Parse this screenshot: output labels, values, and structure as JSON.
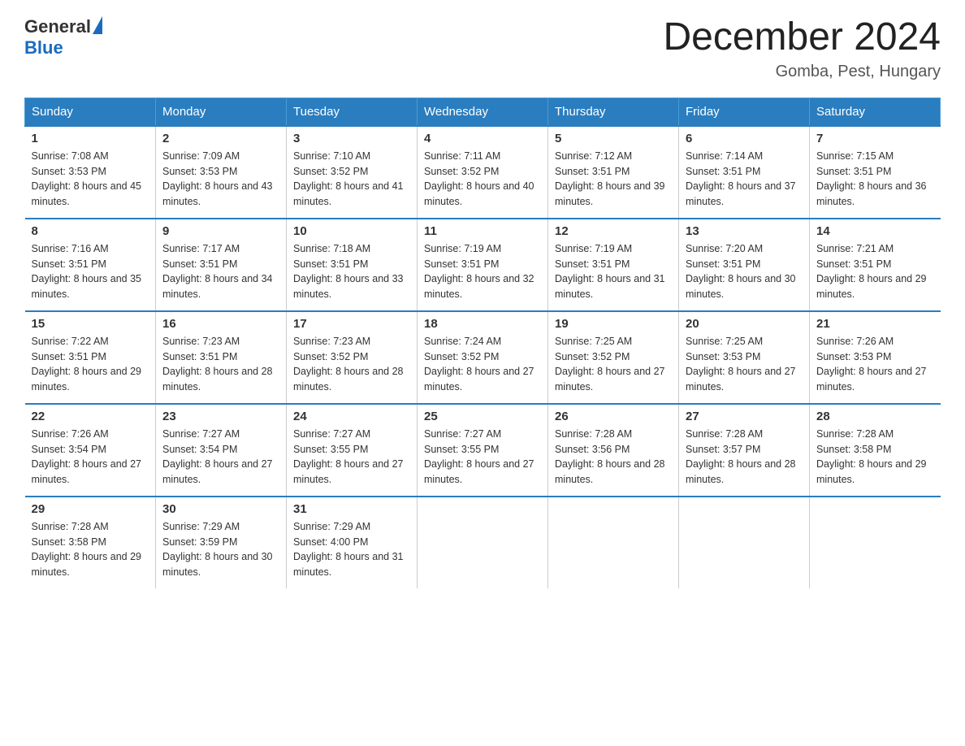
{
  "logo": {
    "general": "General",
    "blue": "Blue"
  },
  "title": {
    "month_year": "December 2024",
    "location": "Gomba, Pest, Hungary"
  },
  "weekdays": [
    "Sunday",
    "Monday",
    "Tuesday",
    "Wednesday",
    "Thursday",
    "Friday",
    "Saturday"
  ],
  "weeks": [
    [
      {
        "day": "1",
        "sunrise": "7:08 AM",
        "sunset": "3:53 PM",
        "daylight": "8 hours and 45 minutes."
      },
      {
        "day": "2",
        "sunrise": "7:09 AM",
        "sunset": "3:53 PM",
        "daylight": "8 hours and 43 minutes."
      },
      {
        "day": "3",
        "sunrise": "7:10 AM",
        "sunset": "3:52 PM",
        "daylight": "8 hours and 41 minutes."
      },
      {
        "day": "4",
        "sunrise": "7:11 AM",
        "sunset": "3:52 PM",
        "daylight": "8 hours and 40 minutes."
      },
      {
        "day": "5",
        "sunrise": "7:12 AM",
        "sunset": "3:51 PM",
        "daylight": "8 hours and 39 minutes."
      },
      {
        "day": "6",
        "sunrise": "7:14 AM",
        "sunset": "3:51 PM",
        "daylight": "8 hours and 37 minutes."
      },
      {
        "day": "7",
        "sunrise": "7:15 AM",
        "sunset": "3:51 PM",
        "daylight": "8 hours and 36 minutes."
      }
    ],
    [
      {
        "day": "8",
        "sunrise": "7:16 AM",
        "sunset": "3:51 PM",
        "daylight": "8 hours and 35 minutes."
      },
      {
        "day": "9",
        "sunrise": "7:17 AM",
        "sunset": "3:51 PM",
        "daylight": "8 hours and 34 minutes."
      },
      {
        "day": "10",
        "sunrise": "7:18 AM",
        "sunset": "3:51 PM",
        "daylight": "8 hours and 33 minutes."
      },
      {
        "day": "11",
        "sunrise": "7:19 AM",
        "sunset": "3:51 PM",
        "daylight": "8 hours and 32 minutes."
      },
      {
        "day": "12",
        "sunrise": "7:19 AM",
        "sunset": "3:51 PM",
        "daylight": "8 hours and 31 minutes."
      },
      {
        "day": "13",
        "sunrise": "7:20 AM",
        "sunset": "3:51 PM",
        "daylight": "8 hours and 30 minutes."
      },
      {
        "day": "14",
        "sunrise": "7:21 AM",
        "sunset": "3:51 PM",
        "daylight": "8 hours and 29 minutes."
      }
    ],
    [
      {
        "day": "15",
        "sunrise": "7:22 AM",
        "sunset": "3:51 PM",
        "daylight": "8 hours and 29 minutes."
      },
      {
        "day": "16",
        "sunrise": "7:23 AM",
        "sunset": "3:51 PM",
        "daylight": "8 hours and 28 minutes."
      },
      {
        "day": "17",
        "sunrise": "7:23 AM",
        "sunset": "3:52 PM",
        "daylight": "8 hours and 28 minutes."
      },
      {
        "day": "18",
        "sunrise": "7:24 AM",
        "sunset": "3:52 PM",
        "daylight": "8 hours and 27 minutes."
      },
      {
        "day": "19",
        "sunrise": "7:25 AM",
        "sunset": "3:52 PM",
        "daylight": "8 hours and 27 minutes."
      },
      {
        "day": "20",
        "sunrise": "7:25 AM",
        "sunset": "3:53 PM",
        "daylight": "8 hours and 27 minutes."
      },
      {
        "day": "21",
        "sunrise": "7:26 AM",
        "sunset": "3:53 PM",
        "daylight": "8 hours and 27 minutes."
      }
    ],
    [
      {
        "day": "22",
        "sunrise": "7:26 AM",
        "sunset": "3:54 PM",
        "daylight": "8 hours and 27 minutes."
      },
      {
        "day": "23",
        "sunrise": "7:27 AM",
        "sunset": "3:54 PM",
        "daylight": "8 hours and 27 minutes."
      },
      {
        "day": "24",
        "sunrise": "7:27 AM",
        "sunset": "3:55 PM",
        "daylight": "8 hours and 27 minutes."
      },
      {
        "day": "25",
        "sunrise": "7:27 AM",
        "sunset": "3:55 PM",
        "daylight": "8 hours and 27 minutes."
      },
      {
        "day": "26",
        "sunrise": "7:28 AM",
        "sunset": "3:56 PM",
        "daylight": "8 hours and 28 minutes."
      },
      {
        "day": "27",
        "sunrise": "7:28 AM",
        "sunset": "3:57 PM",
        "daylight": "8 hours and 28 minutes."
      },
      {
        "day": "28",
        "sunrise": "7:28 AM",
        "sunset": "3:58 PM",
        "daylight": "8 hours and 29 minutes."
      }
    ],
    [
      {
        "day": "29",
        "sunrise": "7:28 AM",
        "sunset": "3:58 PM",
        "daylight": "8 hours and 29 minutes."
      },
      {
        "day": "30",
        "sunrise": "7:29 AM",
        "sunset": "3:59 PM",
        "daylight": "8 hours and 30 minutes."
      },
      {
        "day": "31",
        "sunrise": "7:29 AM",
        "sunset": "4:00 PM",
        "daylight": "8 hours and 31 minutes."
      },
      {
        "day": "",
        "sunrise": "",
        "sunset": "",
        "daylight": ""
      },
      {
        "day": "",
        "sunrise": "",
        "sunset": "",
        "daylight": ""
      },
      {
        "day": "",
        "sunrise": "",
        "sunset": "",
        "daylight": ""
      },
      {
        "day": "",
        "sunrise": "",
        "sunset": "",
        "daylight": ""
      }
    ]
  ],
  "labels": {
    "sunrise": "Sunrise: ",
    "sunset": "Sunset: ",
    "daylight": "Daylight: "
  }
}
